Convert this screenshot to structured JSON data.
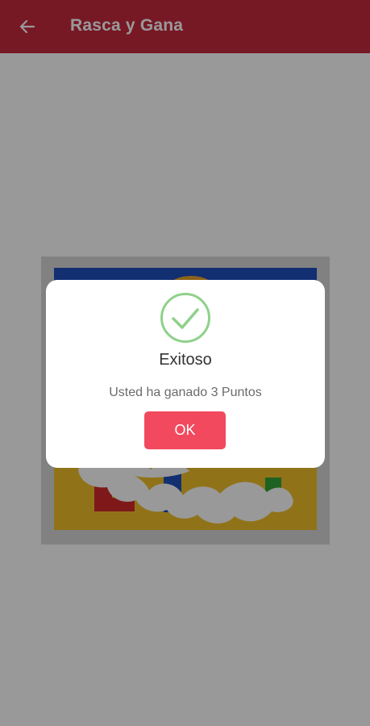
{
  "appbar": {
    "title": "Rasca y Gana",
    "back_icon": "arrow-left-icon"
  },
  "dialog": {
    "icon": "success-check-icon",
    "title": "Exitoso",
    "message": "Usted ha ganado 3 Puntos",
    "ok_label": "OK"
  },
  "colors": {
    "appbar": "#c6283e",
    "ok_button": "#f2495e",
    "success": "#8fd18a",
    "ludo_blue": "#1f4fbf",
    "ludo_yellow": "#f0c02a",
    "ludo_red": "#d42a2a",
    "ludo_green": "#33a33a"
  }
}
